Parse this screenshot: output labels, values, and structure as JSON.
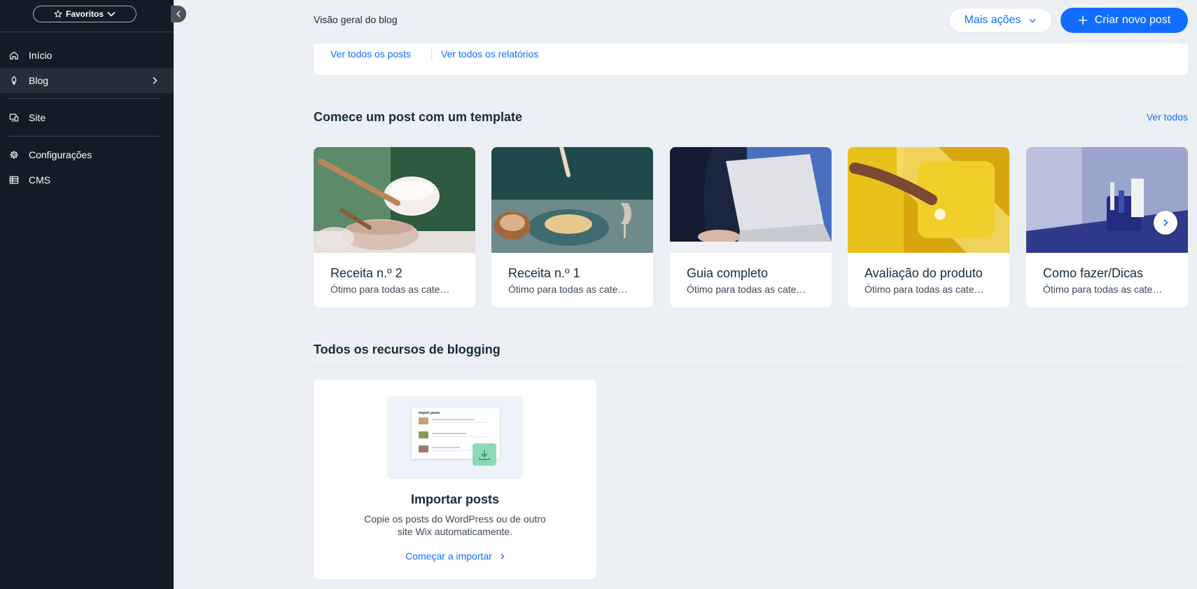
{
  "sidebar": {
    "favorites_label": "Favoritos",
    "items": [
      {
        "label": "Início",
        "icon": "home-icon"
      },
      {
        "label": "Blog",
        "icon": "feather-pen-icon",
        "active": true
      },
      {
        "label": "Site",
        "icon": "site-screens-icon"
      },
      {
        "label": "Configurações",
        "icon": "gear-icon"
      },
      {
        "label": "CMS",
        "icon": "table-icon"
      }
    ]
  },
  "header": {
    "title": "Visão geral do blog",
    "more_actions_label": "Mais ações",
    "create_post_label": "Criar novo post"
  },
  "links": {
    "all_posts": "Ver todos os posts",
    "all_reports": "Ver todos os relatórios"
  },
  "templates": {
    "title": "Comece um post com um template",
    "see_all": "Ver todos",
    "cards": [
      {
        "title": "Receita n.º 2",
        "desc": "Ótimo para todas as cate…"
      },
      {
        "title": "Receita n.º 1",
        "desc": "Ótimo para todas as cate…"
      },
      {
        "title": "Guia completo",
        "desc": "Ótimo para todas as cate…"
      },
      {
        "title": "Avaliação do produto",
        "desc": "Ótimo para todas as cate…"
      },
      {
        "title": "Como fazer/Dicas",
        "desc": "Ótimo para todas as cate…"
      }
    ]
  },
  "resources": {
    "title": "Todos os recursos de blogging",
    "card": {
      "illustration_heading": "Import posts",
      "title": "Importar posts",
      "desc": "Copie os posts do WordPress ou de outro site Wix automaticamente.",
      "link": "Começar a importar"
    }
  },
  "colors": {
    "accent": "#116dff",
    "sidebar_bg": "#131c26",
    "page_bg": "#eceff3"
  }
}
